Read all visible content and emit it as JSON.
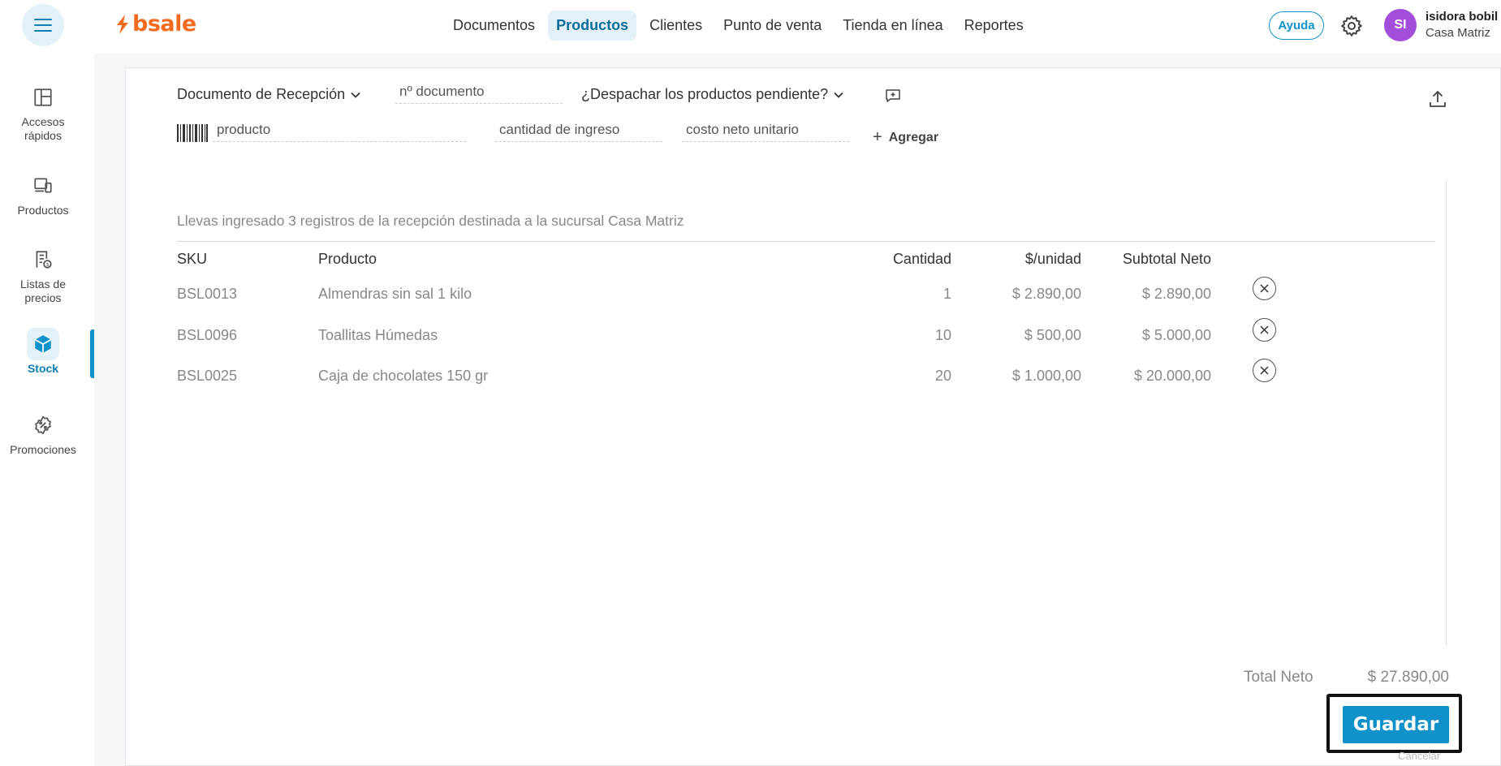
{
  "app": {
    "logo_text": "bsale",
    "brand_color": "#f36b21",
    "accent_color": "#1191c9"
  },
  "header": {
    "nav": [
      "Documentos",
      "Productos",
      "Clientes",
      "Punto de venta",
      "Tienda en línea",
      "Reportes"
    ],
    "active_nav": "Productos",
    "help_label": "Ayuda",
    "avatar_initials": "SI",
    "user_name": "isidora bobil",
    "user_branch": "Casa Matriz"
  },
  "sidebar": {
    "items": [
      {
        "label": "Accesos rápidos",
        "icon": "layout-icon"
      },
      {
        "label": "Productos",
        "icon": "devices-icon"
      },
      {
        "label": "Listas de precios",
        "icon": "price-list-icon"
      },
      {
        "label": "Stock",
        "icon": "box-icon",
        "active": true
      },
      {
        "label": "Promociones",
        "icon": "discount-badge-icon"
      }
    ]
  },
  "form": {
    "document_type": "Documento de Recepción",
    "doc_number_placeholder": "nº documento",
    "dispatch_question": "¿Despachar los productos pendiente?",
    "product_placeholder": "producto",
    "quantity_placeholder": "cantidad de ingreso",
    "cost_placeholder": "costo neto unitario",
    "add_label": "Agregar"
  },
  "records_message": "Llevas ingresado 3 registros de la recepción destinada a la sucursal Casa Matriz",
  "table": {
    "headers": {
      "sku": "SKU",
      "product": "Producto",
      "quantity": "Cantidad",
      "unit_price": "$/unidad",
      "subtotal": "Subtotal Neto"
    },
    "rows": [
      {
        "sku": "BSL0013",
        "product": "Almendras sin sal 1 kilo",
        "quantity": "1",
        "unit_price": "$ 2.890,00",
        "subtotal": "$ 2.890,00"
      },
      {
        "sku": "BSL0096",
        "product": "Toallitas Húmedas",
        "quantity": "10",
        "unit_price": "$ 500,00",
        "subtotal": "$ 5.000,00"
      },
      {
        "sku": "BSL0025",
        "product": "Caja de chocolates 150 gr",
        "quantity": "20",
        "unit_price": "$ 1.000,00",
        "subtotal": "$ 20.000,00"
      }
    ]
  },
  "totals": {
    "label": "Total Neto",
    "value": "$ 27.890,00"
  },
  "actions": {
    "save_label": "Guardar",
    "cancel_label": "Cancelar"
  }
}
